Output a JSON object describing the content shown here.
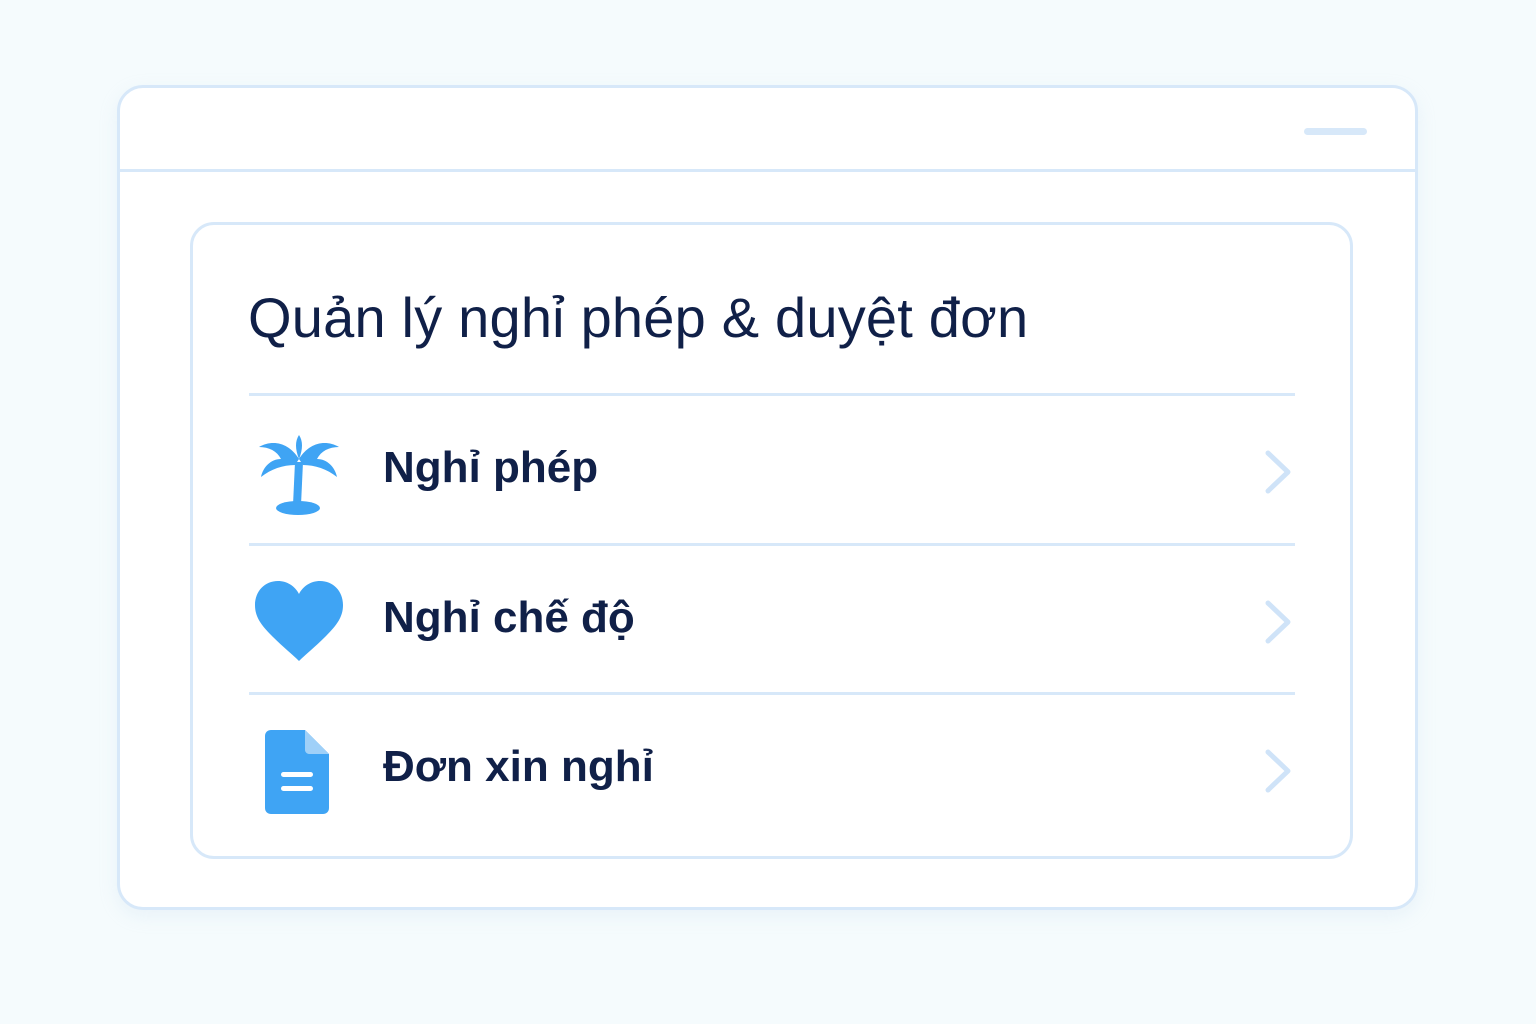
{
  "colors": {
    "background": "#f5fbfd",
    "border": "#d7e8f9",
    "text": "#102048",
    "accent": "#3fa4f4",
    "chevron": "#cfe3f8"
  },
  "window": {
    "minimize_icon": "minimize-bar"
  },
  "card": {
    "title": "Quản lý nghỉ phép & duyệt đơn",
    "items": [
      {
        "label": "Nghỉ phép",
        "icon": "palm-tree-icon",
        "chevron": "chevron-right-icon"
      },
      {
        "label": "Nghỉ chế độ",
        "icon": "heart-icon",
        "chevron": "chevron-right-icon"
      },
      {
        "label": "Đơn xin nghỉ",
        "icon": "document-icon",
        "chevron": "chevron-right-icon"
      }
    ]
  }
}
